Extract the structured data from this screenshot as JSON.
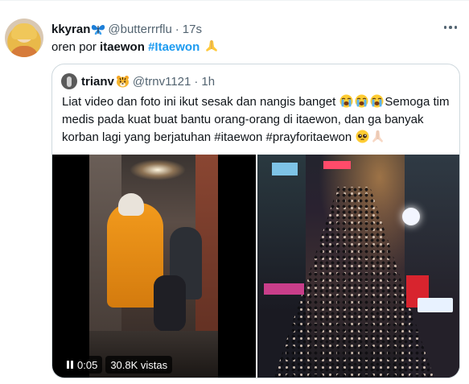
{
  "tweet": {
    "author_name": "kkyran",
    "author_emoji": "butterfly-emoji",
    "handle": "@butterrrflu",
    "separator": "·",
    "time": "17s",
    "text_before": "oren por ",
    "text_bold": "itaewon",
    "hashtag": "#Itaewon",
    "text_emoji": "folded-hands-emoji"
  },
  "quote": {
    "author_name": "trianv",
    "author_emoji": "tiger-emoji",
    "handle": "@trnv1121",
    "separator": "·",
    "time": "1h",
    "text_part1": "Liat video dan foto ini ikut sesak dan nangis banget",
    "text_part2": "Semoga tim medis pada kuat buat bantu orang-orang di itaewon, dan ga banyak korban lagi yang berjatuhan #itaewon #prayforitaewon",
    "emojis": [
      "loudly-crying-face",
      "loudly-crying-face",
      "loudly-crying-face",
      "pleading-face",
      "folded-hands-light-skin"
    ]
  },
  "video": {
    "time": "0:05",
    "views": "30.8K vistas"
  },
  "colors": {
    "link": "#1d9bf0",
    "text": "#0f1419",
    "muted": "#536471",
    "border": "#cfd9de"
  }
}
